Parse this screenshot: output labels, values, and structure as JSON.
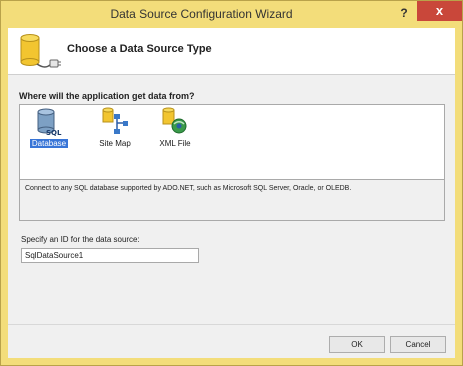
{
  "window": {
    "title": "Data Source Configuration Wizard",
    "help_label": "?",
    "close_label": "x"
  },
  "header": {
    "title": "Choose a Data Source Type",
    "icon": "database-plug-icon"
  },
  "prompt": {
    "question": "Where will the application get data from?"
  },
  "data_source_types": [
    {
      "label": "Database",
      "icon": "sql-database-icon",
      "selected": true
    },
    {
      "label": "Site Map",
      "icon": "site-map-icon",
      "selected": false
    },
    {
      "label": "XML File",
      "icon": "xml-file-icon",
      "selected": false
    }
  ],
  "description": "Connect to any SQL database supported by ADO.NET, such as Microsoft SQL Server, Oracle, or OLEDB.",
  "id_field": {
    "label": "Specify an ID for the data source:",
    "value": "SqlDataSource1"
  },
  "buttons": {
    "ok": "OK",
    "cancel": "Cancel"
  },
  "colors": {
    "title_bar": "#f3dd7a",
    "close_button": "#c9473a",
    "selection": "#3875d7"
  }
}
